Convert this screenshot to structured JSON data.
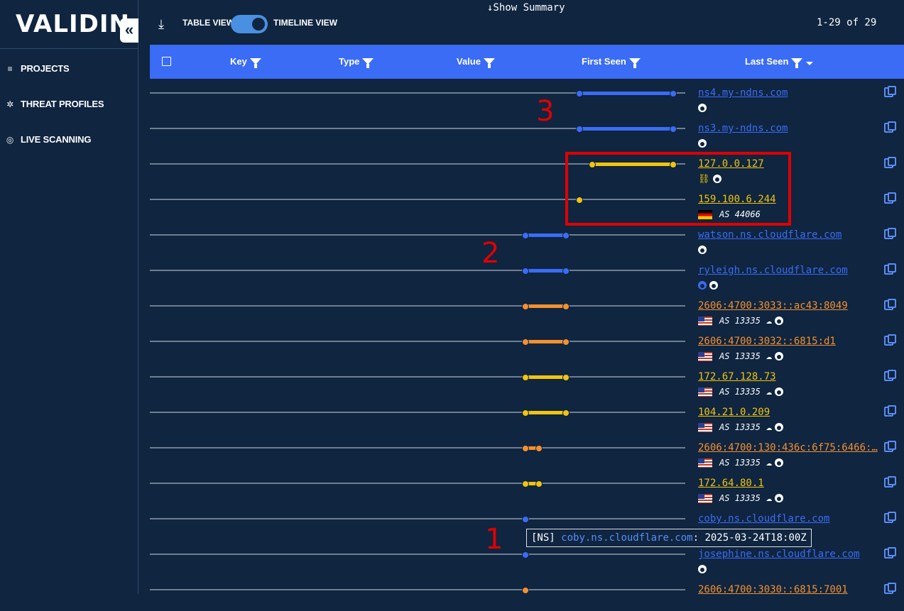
{
  "sidebar": {
    "logo": "VALIDIN",
    "collapse_icon": "«",
    "items": [
      {
        "label": "PROJECTS",
        "icon": "≡"
      },
      {
        "label": "THREAT PROFILES",
        "icon": "✲"
      },
      {
        "label": "LIVE SCANNING",
        "icon": "◎"
      }
    ]
  },
  "toolbar": {
    "show_summary": "↓Show Summary",
    "table_view": "TABLE VIEW",
    "timeline_view": "TIMELINE VIEW",
    "pager": "1-29 of 29",
    "toggle_state": "timeline"
  },
  "table": {
    "columns": [
      "Key",
      "Type",
      "Value",
      "First Seen",
      "Last Seen"
    ],
    "rows": [
      {
        "value": "ns4.my-ndns.com",
        "color": "#3b6cf5",
        "start": 604,
        "end": 736,
        "meta": {
          "icons": [
            "fire"
          ]
        }
      },
      {
        "value": "ns3.my-ndns.com",
        "color": "#3b6cf5",
        "start": 604,
        "end": 736,
        "meta": {
          "icons": [
            "fire"
          ]
        }
      },
      {
        "value": "127.0.0.127",
        "color": "#f1c40f",
        "start": 622,
        "end": 736,
        "meta": {
          "icons": [
            "broken",
            "fire"
          ]
        }
      },
      {
        "value": "159.100.6.244",
        "color": "#f1c40f",
        "start": 604,
        "end": 604,
        "meta": {
          "flag": "de",
          "asn": "AS 44066"
        }
      },
      {
        "value": "watson.ns.cloudflare.com",
        "color": "#3b6cf5",
        "start": 528,
        "end": 585,
        "meta": {
          "icons": [
            "fire"
          ]
        }
      },
      {
        "value": "ryleigh.ns.cloudflare.com",
        "color": "#3b6cf5",
        "start": 528,
        "end": 585,
        "meta": {
          "icons": [
            "fire-blue",
            "fire"
          ]
        }
      },
      {
        "value": "2606:4700:3033::ac43:8049",
        "color": "#f5902e",
        "start": 528,
        "end": 585,
        "meta": {
          "flag": "us",
          "asn": "AS 13335",
          "icons": [
            "cloud",
            "fire"
          ]
        }
      },
      {
        "value": "2606:4700:3032::6815:d1",
        "color": "#f5902e",
        "start": 528,
        "end": 585,
        "meta": {
          "flag": "us",
          "asn": "AS 13335",
          "icons": [
            "cloud",
            "fire"
          ]
        }
      },
      {
        "value": "172.67.128.73",
        "color": "#f1c40f",
        "start": 528,
        "end": 585,
        "meta": {
          "flag": "us",
          "asn": "AS 13335",
          "icons": [
            "cloud",
            "fire"
          ]
        }
      },
      {
        "value": "104.21.0.209",
        "color": "#f1c40f",
        "start": 528,
        "end": 585,
        "meta": {
          "flag": "us",
          "asn": "AS 13335",
          "icons": [
            "cloud",
            "fire"
          ]
        }
      },
      {
        "value": "2606:4700:130:436c:6f75:6466:…",
        "color": "#f5902e",
        "start": 528,
        "end": 547,
        "meta": {
          "flag": "us",
          "asn": "AS 13335",
          "icons": [
            "cloud",
            "fire"
          ]
        }
      },
      {
        "value": "172.64.80.1",
        "color": "#f1c40f",
        "start": 528,
        "end": 547,
        "meta": {
          "flag": "us",
          "asn": "AS 13335",
          "icons": [
            "cloud",
            "fire"
          ]
        }
      },
      {
        "value": "coby.ns.cloudflare.com",
        "color": "#3b6cf5",
        "start": 528,
        "end": 528,
        "meta": {}
      },
      {
        "value": "josephine.ns.cloudflare.com",
        "color": "#3b6cf5",
        "start": 528,
        "end": 528,
        "meta": {
          "icons": [
            "fire"
          ]
        }
      },
      {
        "value": "2606:4700:3030::6815:7001",
        "color": "#f5902e",
        "start": 528,
        "end": 528,
        "meta": {}
      }
    ]
  },
  "tooltip": {
    "type": "[NS]",
    "value": "coby.ns.cloudflare.com",
    "timestamp": ": 2025-03-24T18:00Z"
  },
  "annotations": [
    "1",
    "2",
    "3"
  ],
  "colors": {
    "background": "#0f2540",
    "header": "#3b6cf5",
    "ns": "#3b6cf5",
    "ipv6": "#f5902e",
    "ipv4": "#f1c40f",
    "highlight": "#e00000"
  }
}
